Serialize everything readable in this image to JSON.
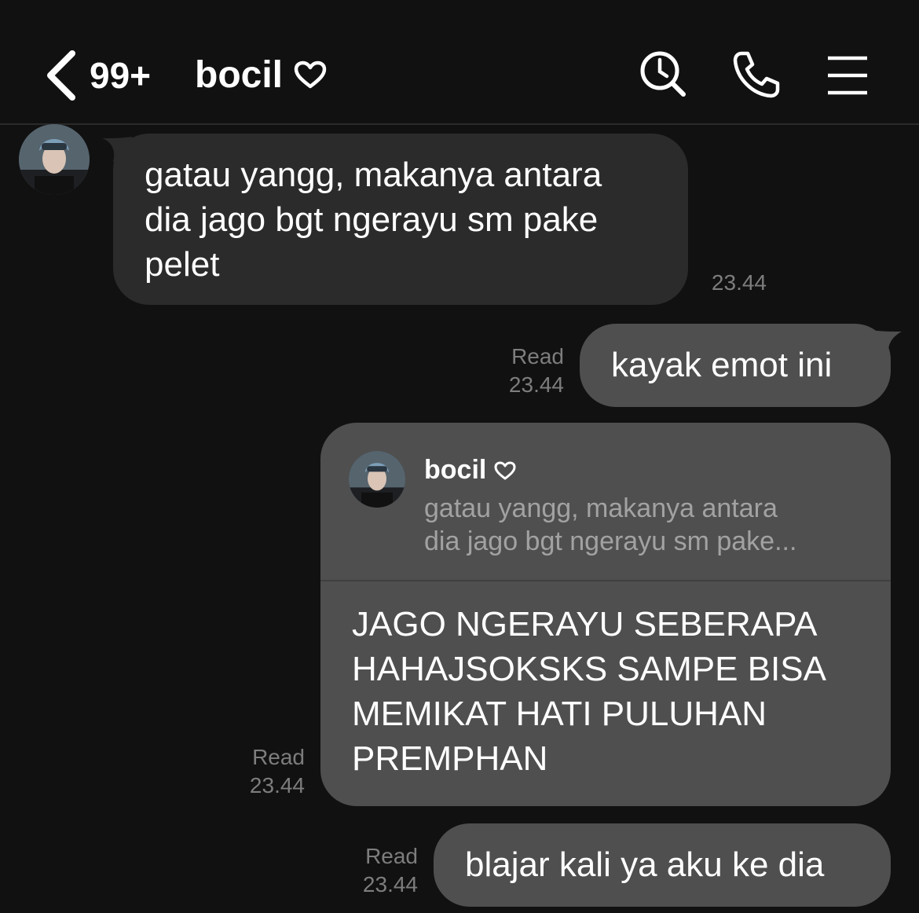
{
  "header": {
    "unread_badge": "99+",
    "chat_name": "bocil"
  },
  "messages": [
    {
      "direction": "incoming",
      "text": "gatau yangg, makanya antara\ndia jago bgt ngerayu sm pake\npelet",
      "time": "23.44"
    },
    {
      "direction": "outgoing",
      "text": "kayak emot ini",
      "read_label": "Read",
      "time": "23.44"
    },
    {
      "direction": "outgoing",
      "reply_to": {
        "name": "bocil",
        "snippet_lines": [
          "gatau yangg, makanya antara",
          "dia jago bgt ngerayu sm pake..."
        ]
      },
      "text": "JAGO NGERAYU SEBERAPA\nHAHAJSOKSKS SAMPE BISA\nMEMIKAT HATI PULUHAN\nPREMPHAN",
      "read_label": "Read",
      "time": "23.44"
    },
    {
      "direction": "outgoing",
      "text": "blajar kali ya aku ke dia",
      "read_label": "Read",
      "time": "23.44"
    }
  ],
  "colors": {
    "background": "#111111",
    "incoming_bubble": "#2b2b2b",
    "outgoing_bubble": "#4f4f4f",
    "meta_text": "#7d7d7d"
  },
  "icons": [
    "back-chevron-icon",
    "heart-outline-icon",
    "search-icon",
    "phone-icon",
    "menu-icon"
  ]
}
